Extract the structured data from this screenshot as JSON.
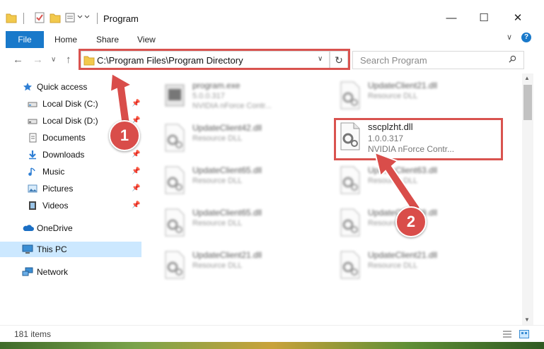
{
  "window": {
    "title": "Program",
    "minimize": "—",
    "maximize": "☐",
    "close": "✕"
  },
  "ribbon": {
    "file": "File",
    "home": "Home",
    "share": "Share",
    "view": "View",
    "help": "?",
    "collapse": "∨"
  },
  "nav": {
    "back": "←",
    "forward": "→",
    "recent": "∨",
    "up": "↑"
  },
  "address": {
    "path": "C:\\Program Files\\Program Directory",
    "chevron": "∨",
    "refresh": "↻"
  },
  "search": {
    "placeholder": "Search Program"
  },
  "sidebar": {
    "quick_access": "Quick access",
    "items": [
      {
        "label": "Local Disk (C:)",
        "icon": "drive-icon"
      },
      {
        "label": "Local Disk (D:)",
        "icon": "drive-icon"
      },
      {
        "label": "Documents",
        "icon": "documents-icon"
      },
      {
        "label": "Downloads",
        "icon": "downloads-icon"
      },
      {
        "label": "Music",
        "icon": "music-icon"
      },
      {
        "label": "Pictures",
        "icon": "pictures-icon"
      },
      {
        "label": "Videos",
        "icon": "videos-icon"
      }
    ],
    "onedrive": "OneDrive",
    "this_pc": "This PC",
    "network": "Network"
  },
  "files": [
    {
      "name": "program.exe",
      "line1": "5.0.0.317",
      "line2": "NVIDIA nForce Contr..."
    },
    {
      "name": "UpdateClient21.dll",
      "line1": "Resource DLL",
      "line2": ""
    },
    {
      "name": "UpdateClient42.dll",
      "line1": "Resource DLL",
      "line2": ""
    },
    {
      "name": "sscplzht.dll",
      "line1": "1.0.0.317",
      "line2": "NVIDIA nForce Contr..."
    },
    {
      "name": "UpdateClient65.dll",
      "line1": "Resource DLL",
      "line2": ""
    },
    {
      "name": "UpdateClient63.dll",
      "line1": "Resource DLL",
      "line2": ""
    },
    {
      "name": "UpdateClient65.dll",
      "line1": "Resource DLL",
      "line2": ""
    },
    {
      "name": "UpdateClient19.dll",
      "line1": "Resource DLL",
      "line2": ""
    },
    {
      "name": "UpdateClient21.dll",
      "line1": "Resource DLL",
      "line2": ""
    },
    {
      "name": "UpdateClient21.dll",
      "line1": "Resource DLL",
      "line2": ""
    }
  ],
  "status": {
    "count": "181 items"
  },
  "callouts": {
    "one": "1",
    "two": "2"
  },
  "colors": {
    "accent": "#1979ca",
    "highlight": "#d9534f",
    "selected": "#cce8ff"
  }
}
